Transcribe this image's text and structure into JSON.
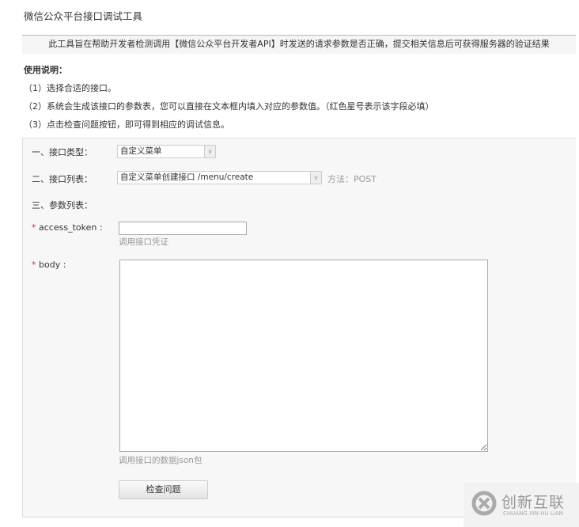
{
  "title": "微信公众平台接口调试工具",
  "banner": "此工具旨在帮助开发者检测调用【微信公众平台开发者API】时发送的请求参数是否正确，提交相关信息后可获得服务器的验证结果",
  "usage": {
    "title": "使用说明：",
    "steps": [
      "（1）选择合适的接口。",
      "（2）系统会生成该接口的参数表，您可以直接在文本框内填入对应的参数值。（红色星号表示该字段必填）",
      "（3）点击检查问题按钮，即可得到相应的调试信息。"
    ]
  },
  "form": {
    "type_label": "一、接口类型：",
    "type_value": "自定义菜单",
    "list_label": "二、接口列表：",
    "list_value": "自定义菜单创建接口 /menu/create",
    "method": "方法：POST",
    "params_label": "三、参数列表：",
    "required_mark": "*",
    "access_token_label": "access_token :",
    "access_token_value": "",
    "access_token_hint": "调用接口凭证",
    "body_label": "body :",
    "body_value": "",
    "body_hint": "调用接口的数据json包",
    "submit": "检查问题"
  },
  "watermark": {
    "name": "创新互联",
    "sub": "CHUANG XIN HU LIAN"
  }
}
